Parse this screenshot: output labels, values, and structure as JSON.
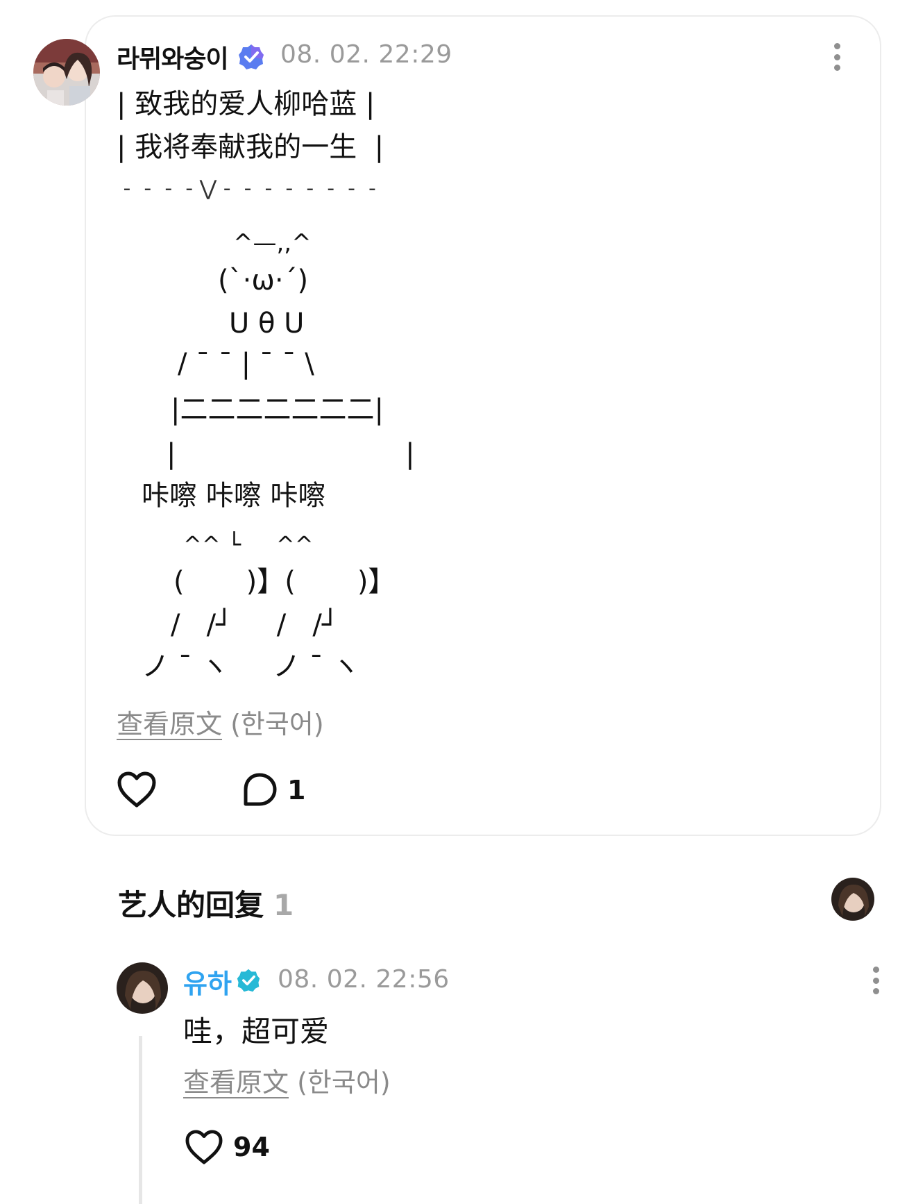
{
  "post": {
    "author": "라뮈와숭이",
    "timestamp": "08. 02. 22:29",
    "lines": [
      "| 致我的爱人柳哈蓝 |",
      "| 我将奉献我的一生  |",
      " -  -  -  - ⋁ -  -  -  -  -  -  -  -",
      "^—,,^",
      "(`·ω·´)",
      "U θ U",
      "/ ¯ ¯ | ¯ ¯ \\",
      "|二二二二二二二|",
      "|                          |",
      "咔嚓 咔嚓 咔嚓",
      "^^ └     ^^",
      "(       )】(       )】",
      "/   /┘     /   /┘",
      "ノ ¯ ヽ     ノ ¯ ヽ"
    ],
    "translate_link": "查看原文",
    "translate_lang": "(한국어)",
    "comment_count": "1",
    "icons": {
      "avatar": "user-avatar",
      "badge": "verified-badge-icon",
      "more": "more-vertical-icon",
      "like": "heart-icon",
      "comment": "comment-bubble-icon"
    }
  },
  "replies_section": {
    "title": "艺人的回复",
    "count": "1"
  },
  "reply": {
    "author": "유하",
    "timestamp": "08. 02. 22:56",
    "text": "哇，超可爱",
    "translate_link": "查看原文",
    "translate_lang": "(한국어)",
    "like_count": "94"
  },
  "colors": {
    "artist_name": "#2fa3f0",
    "verified_badge_post": "#5a7cf0",
    "verified_badge_reply": "#27b9d6",
    "muted_text": "#9a9a9a",
    "card_border": "#ececec"
  }
}
